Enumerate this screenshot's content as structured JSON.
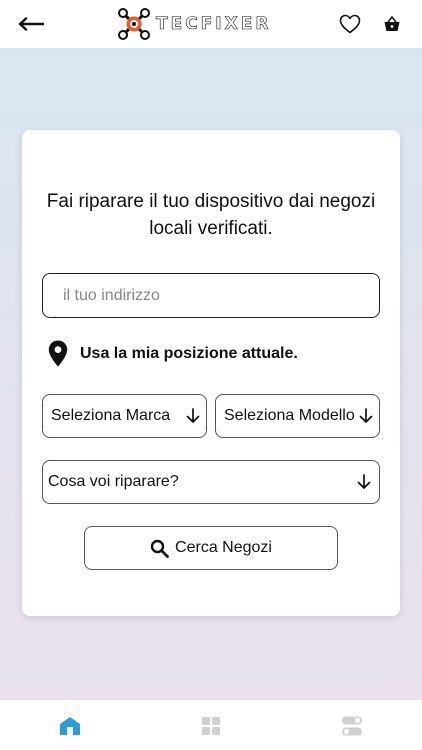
{
  "header": {
    "brand": "TECFIXER",
    "back_icon": "arrow-left-icon",
    "wishlist_icon": "heart-icon",
    "cart_icon": "basket-icon"
  },
  "card": {
    "headline": "Fai riparare il tuo dispositivo dai negozi locali verificati.",
    "address_placeholder": "il tuo indirizzo",
    "address_value": "",
    "use_location_label": "Usa la mia posizione attuale.",
    "brand_select": "Seleziona Marca",
    "model_select": "Seleziona Modello",
    "repair_select": "Cosa voi riparare?",
    "search_button": "Cerca Negozi"
  },
  "tabs": [
    {
      "icon": "home-icon",
      "active": true
    },
    {
      "icon": "grid-icon",
      "active": false
    },
    {
      "icon": "toggle-settings-icon",
      "active": false
    }
  ],
  "colors": {
    "accent": "#2a9fd6",
    "logo_orange": "#f15a24",
    "inactive_tab": "#d0d0d0",
    "text": "#111111"
  }
}
